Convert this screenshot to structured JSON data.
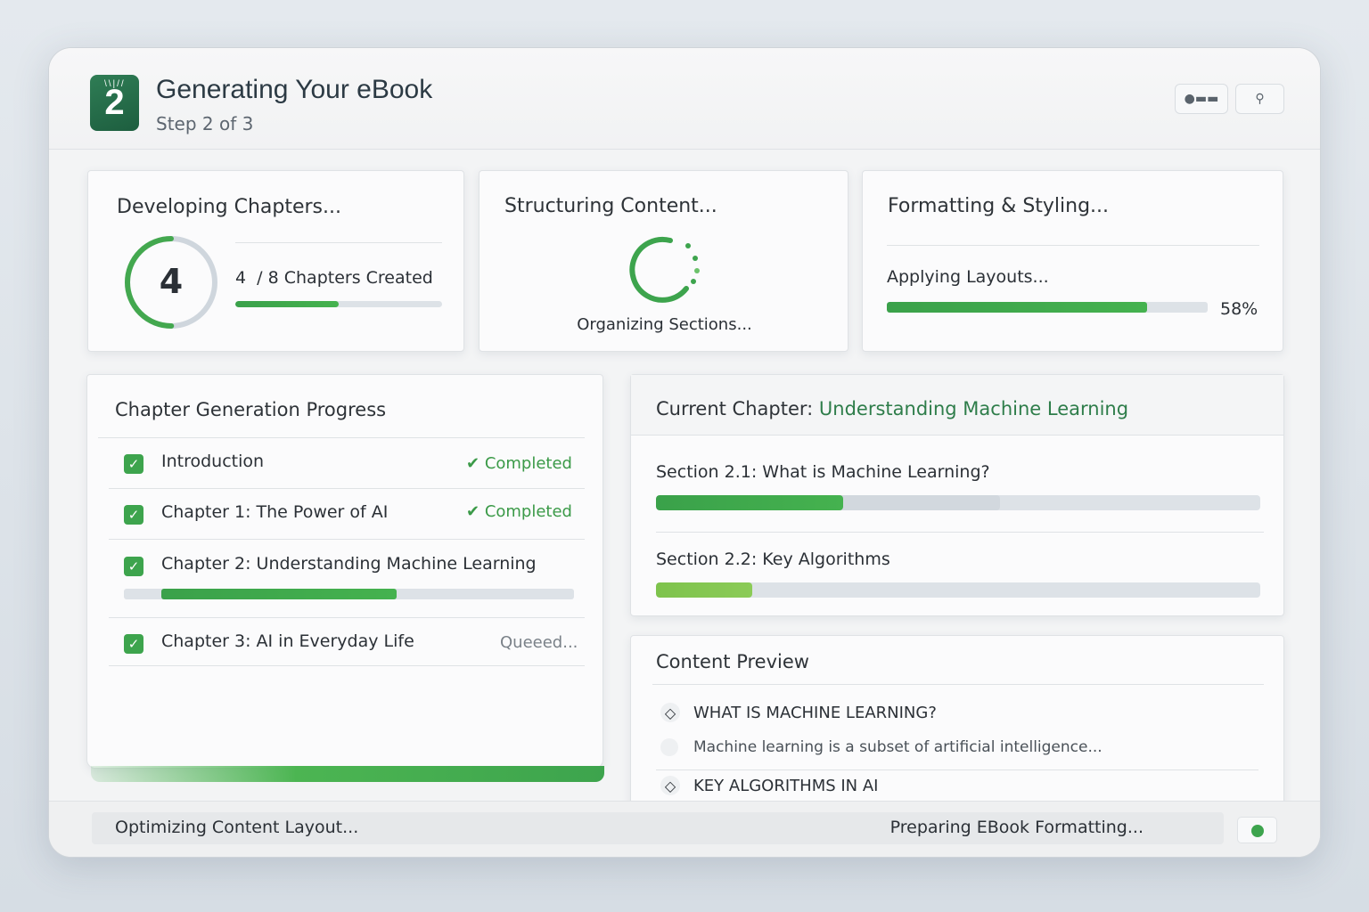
{
  "header": {
    "logo_digit": "2",
    "title": "Generating Your eBook",
    "subtitle": "Step 2 of 3"
  },
  "cards": {
    "chapters": {
      "title": "Developing Chapters...",
      "ring_value": "4",
      "ring_fraction": 0.5,
      "count_text": "4  / 8 Chapters Created",
      "progress": 0.5
    },
    "structuring": {
      "title": "Structuring Content...",
      "caption": "Organizing Sections..."
    },
    "formatting": {
      "title": "Formatting & Styling...",
      "caption": "Applying Layouts...",
      "percent_label": "58%",
      "progress": 0.81
    }
  },
  "chapter_progress": {
    "title": "Chapter Generation Progress",
    "items": [
      {
        "label": "Introduction",
        "status": "Completed"
      },
      {
        "label": "Chapter 1: The Power of AI",
        "status": "Completed"
      },
      {
        "label": "Chapter 2: Understanding Machine Learning",
        "status": "",
        "progress": 0.57
      },
      {
        "label": "Chapter 3: AI in Everyday Life",
        "status": "Queeed..."
      }
    ]
  },
  "current_chapter": {
    "prefix": "Current Chapter:",
    "name": "Understanding Machine Learning",
    "sections": [
      {
        "label": "Section 2.1: What is Machine Learning?",
        "progress": 0.31,
        "secondary": 0.57
      },
      {
        "label": "Section 2.2: Key Algorithms",
        "progress": 0.16
      }
    ]
  },
  "content_preview": {
    "title": "Content Preview",
    "items": [
      {
        "heading": "WHAT IS MACHINE LEARNING?",
        "excerpt": "Machine learning is a subset of artificial intelligence..."
      },
      {
        "heading": "KEY ALGORITHMS IN AI"
      }
    ]
  },
  "footer": {
    "left": "Optimizing Content Layout...",
    "right": "Preparing EBook Formatting..."
  },
  "colors": {
    "accent": "#3da44d",
    "accent_dark": "#1d5e3f",
    "link_green": "#2e7d4a"
  }
}
